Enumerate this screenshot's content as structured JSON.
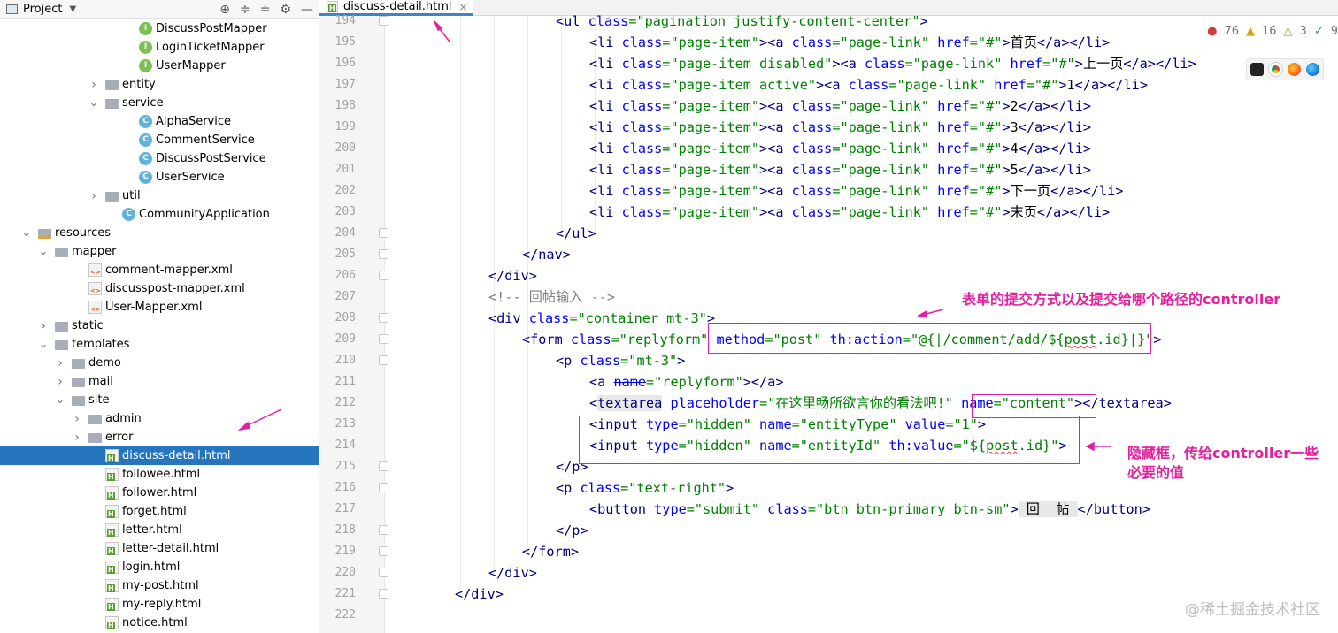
{
  "sidebar": {
    "title": "Project",
    "items": [
      {
        "label": "DiscussPostMapper",
        "icon": "interface",
        "indent": 176,
        "arrow": ""
      },
      {
        "label": "LoginTicketMapper",
        "icon": "interface",
        "indent": 176,
        "arrow": ""
      },
      {
        "label": "UserMapper",
        "icon": "interface",
        "indent": 176,
        "arrow": ""
      },
      {
        "label": "entity",
        "icon": "folder",
        "indent": 138,
        "arrow": "right"
      },
      {
        "label": "service",
        "icon": "folder",
        "indent": 138,
        "arrow": "down"
      },
      {
        "label": "AlphaService",
        "icon": "class",
        "indent": 176,
        "arrow": ""
      },
      {
        "label": "CommentService",
        "icon": "class",
        "indent": 176,
        "arrow": ""
      },
      {
        "label": "DiscussPostService",
        "icon": "class",
        "indent": 176,
        "arrow": ""
      },
      {
        "label": "UserService",
        "icon": "class",
        "indent": 176,
        "arrow": ""
      },
      {
        "label": "util",
        "icon": "folder",
        "indent": 138,
        "arrow": "right"
      },
      {
        "label": "CommunityApplication",
        "icon": "app",
        "indent": 157,
        "arrow": ""
      },
      {
        "label": "resources",
        "icon": "resfolder",
        "indent": 62,
        "arrow": "down"
      },
      {
        "label": "mapper",
        "icon": "folder",
        "indent": 81,
        "arrow": "down"
      },
      {
        "label": "comment-mapper.xml",
        "icon": "xml",
        "indent": 119,
        "arrow": ""
      },
      {
        "label": "discusspost-mapper.xml",
        "icon": "xml",
        "indent": 119,
        "arrow": ""
      },
      {
        "label": "User-Mapper.xml",
        "icon": "xml",
        "indent": 119,
        "arrow": ""
      },
      {
        "label": "static",
        "icon": "folder",
        "indent": 81,
        "arrow": "right"
      },
      {
        "label": "templates",
        "icon": "folder",
        "indent": 81,
        "arrow": "down"
      },
      {
        "label": "demo",
        "icon": "folder",
        "indent": 100,
        "arrow": "right"
      },
      {
        "label": "mail",
        "icon": "folder",
        "indent": 100,
        "arrow": "right"
      },
      {
        "label": "site",
        "icon": "folder",
        "indent": 100,
        "arrow": "down"
      },
      {
        "label": "admin",
        "icon": "folder",
        "indent": 119,
        "arrow": "right"
      },
      {
        "label": "error",
        "icon": "folder",
        "indent": 119,
        "arrow": "right"
      },
      {
        "label": "discuss-detail.html",
        "icon": "html",
        "indent": 138,
        "arrow": "",
        "selected": true
      },
      {
        "label": "followee.html",
        "icon": "html",
        "indent": 138,
        "arrow": ""
      },
      {
        "label": "follower.html",
        "icon": "html",
        "indent": 138,
        "arrow": ""
      },
      {
        "label": "forget.html",
        "icon": "html",
        "indent": 138,
        "arrow": ""
      },
      {
        "label": "letter.html",
        "icon": "html",
        "indent": 138,
        "arrow": ""
      },
      {
        "label": "letter-detail.html",
        "icon": "html",
        "indent": 138,
        "arrow": ""
      },
      {
        "label": "login.html",
        "icon": "html",
        "indent": 138,
        "arrow": ""
      },
      {
        "label": "my-post.html",
        "icon": "html",
        "indent": 138,
        "arrow": ""
      },
      {
        "label": "my-reply.html",
        "icon": "html",
        "indent": 138,
        "arrow": ""
      },
      {
        "label": "notice.html",
        "icon": "html",
        "indent": 138,
        "arrow": ""
      }
    ]
  },
  "editor": {
    "tab_label": "discuss-detail.html",
    "line_numbers": [
      "194",
      "195",
      "196",
      "197",
      "198",
      "199",
      "200",
      "201",
      "202",
      "203",
      "204",
      "205",
      "206",
      "207",
      "208",
      "209",
      "210",
      "211",
      "212",
      "213",
      "214",
      "215",
      "216",
      "217",
      "218",
      "219",
      "220",
      "221",
      "222"
    ],
    "code": {
      "l194": [
        "<ul ",
        "class",
        "=",
        "\"pagination justify-content-center\"",
        ">"
      ],
      "l195_text": "首页",
      "l196_text": "上一页",
      "l197_text": "1",
      "l198_text": "2",
      "l199_text": "3",
      "l200_text": "4",
      "l201_text": "5",
      "l202_text": "下一页",
      "l203_text": "末页",
      "comment_207": "<!-- 回帖输入 -->",
      "placeholder_212": "\"在这里畅所欲言你的看法吧!\"",
      "button_text_217": "回  帖"
    }
  },
  "status": {
    "errors": "76",
    "warnings": "16",
    "weak_warnings": "3",
    "ok": "9"
  },
  "annotations": {
    "form_note": "表单的提交方式以及提交给哪个路径的controller",
    "hidden_note": "隐藏框，传给controller一些必要的值"
  },
  "watermark": "@稀土掘金技术社区"
}
